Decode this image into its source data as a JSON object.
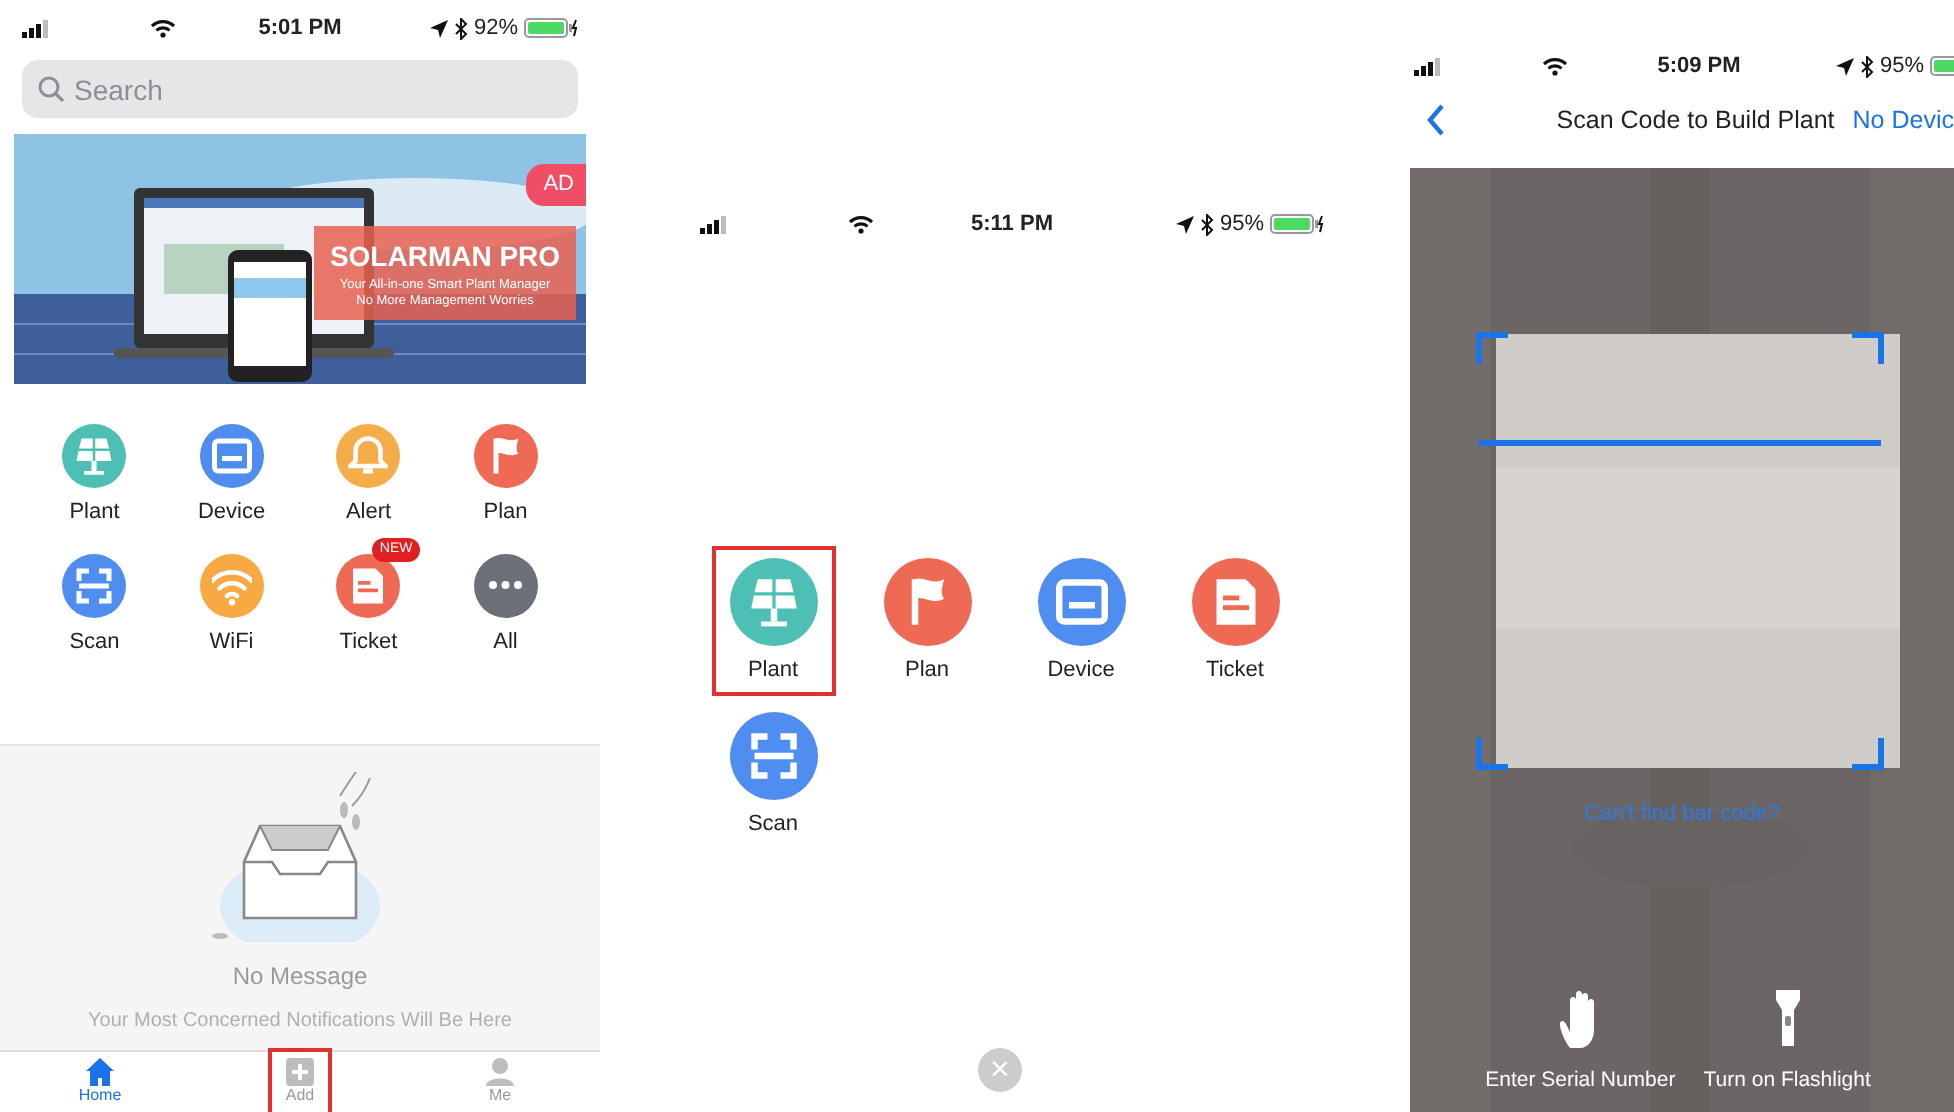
{
  "home_screen": {
    "status_bar": {
      "time": "5:01 PM",
      "battery": "92%"
    },
    "search": {
      "placeholder": "Search"
    },
    "banner": {
      "badge": "AD",
      "title": "SOLARMAN PRO",
      "subtitle": "Your All-in-one Smart Plant Manager",
      "subtitle_2": "No More Management Worries"
    },
    "shortcuts": [
      {
        "label": "Plant",
        "kind": "plant",
        "color": "#4dbfb4"
      },
      {
        "label": "Device",
        "kind": "device",
        "color": "#4f8ef0"
      },
      {
        "label": "Alert",
        "kind": "alert",
        "color": "#f5ad4a"
      },
      {
        "label": "Plan",
        "kind": "plan",
        "color": "#ef6a55"
      },
      {
        "label": "Scan",
        "kind": "scan",
        "color": "#4f8ef0"
      },
      {
        "label": "WiFi",
        "kind": "wifi",
        "color": "#f7a944"
      },
      {
        "label": "Ticket",
        "kind": "ticket",
        "color": "#ef6a55",
        "badge": "NEW"
      },
      {
        "label": "All",
        "kind": "more",
        "color": "#6b7079"
      }
    ],
    "empty_state": {
      "title": "No Message",
      "hint": "Your Most Concerned Notifications Will Be Here"
    },
    "tabs": [
      {
        "label": "Home",
        "kind": "home",
        "selected": true,
        "highlighted": false
      },
      {
        "label": "Add",
        "kind": "add",
        "selected": false,
        "highlighted": true
      },
      {
        "label": "Me",
        "kind": "me",
        "selected": false,
        "highlighted": false
      }
    ]
  },
  "add_menu": {
    "status_bar": {
      "time": "5:11 PM",
      "battery": "95%"
    },
    "items": [
      {
        "label": "Plant",
        "kind": "plant",
        "color": "#4dbfb4",
        "highlighted": true
      },
      {
        "label": "Plan",
        "kind": "plan",
        "color": "#ef6a55",
        "highlighted": false
      },
      {
        "label": "Device",
        "kind": "device",
        "color": "#4f8ef0",
        "highlighted": false
      },
      {
        "label": "Ticket",
        "kind": "ticket",
        "color": "#ef6a55",
        "highlighted": false
      },
      {
        "label": "Scan",
        "kind": "scan",
        "color": "#4f8ef0",
        "highlighted": false
      }
    ],
    "close": "×"
  },
  "scan_screen": {
    "status_bar": {
      "time": "5:09 PM",
      "battery": "95%"
    },
    "title": "Scan Code to Build Plant",
    "action": "No Devic",
    "hint": "Can't find bar code?",
    "actions": [
      {
        "label": "Enter Serial Number",
        "kind": "hand"
      },
      {
        "label": "Turn on Flashlight",
        "kind": "flashlight"
      }
    ]
  }
}
